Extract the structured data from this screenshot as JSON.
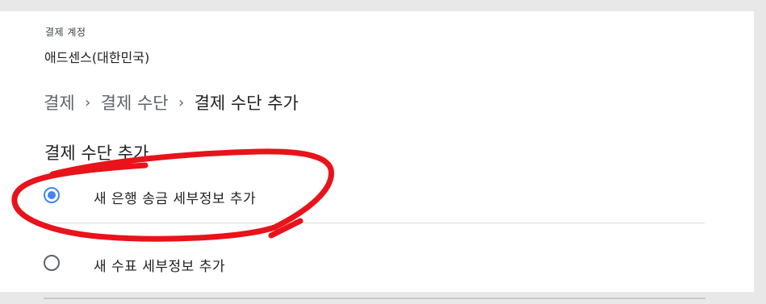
{
  "account": {
    "label": "결제 계정",
    "name": "애드센스(대한민국)"
  },
  "breadcrumb": {
    "items": [
      "결제",
      "결제 수단",
      "결제 수단 추가"
    ],
    "separator": "›"
  },
  "section": {
    "title": "결제 수단 추가"
  },
  "options": [
    {
      "label": "새 은행 송금 세부정보 추가",
      "selected": true
    },
    {
      "label": "새 수표 세부정보 추가",
      "selected": false
    }
  ],
  "colors": {
    "accent": "#4285f4",
    "annotation": "#e8131b"
  }
}
